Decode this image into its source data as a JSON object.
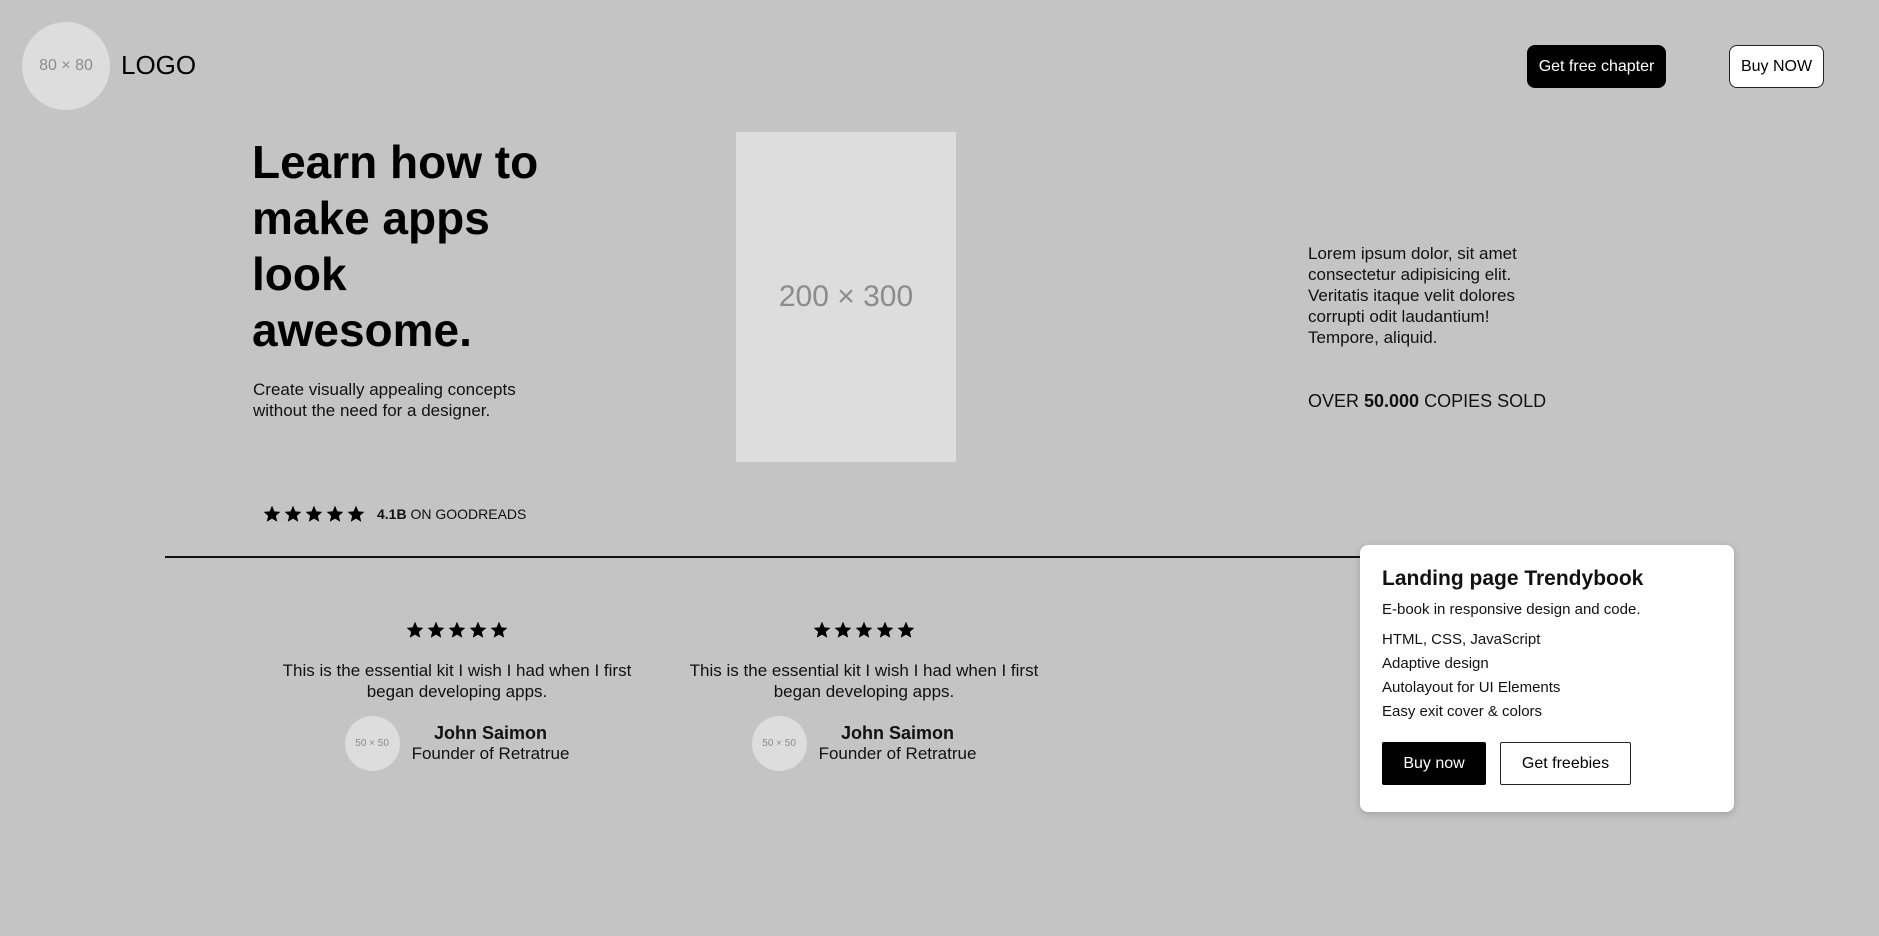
{
  "header": {
    "logo_placeholder": "80 × 80",
    "logo_text": "LOGO",
    "free_chapter_label": "Get free chapter",
    "buy_label": "Buy NOW"
  },
  "hero": {
    "title": "Learn how to make apps look awesome.",
    "subtitle": "Create visually appealing concepts without the need for a designer.",
    "book_placeholder": "200 × 300",
    "description": "Lorem ipsum dolor, sit amet consectetur adipisicing elit. Veritatis itaque velit dolores corrupti odit laudantium! Tempore, aliquid.",
    "copies_prefix": "OVER ",
    "copies_count": "50.000",
    "copies_suffix": " COPIES SOLD"
  },
  "rating": {
    "stars": 5,
    "score": "4.1B",
    "source": "ON GOODREADS"
  },
  "testimonials": [
    {
      "stars": 5,
      "quote": "This is the essential kit I wish I had when I first began developing apps.",
      "avatar_placeholder": "50 × 50",
      "name": "John Saimon",
      "role": "Founder of Retratrue"
    },
    {
      "stars": 5,
      "quote": "This is the essential kit I wish I had when I first began developing apps.",
      "avatar_placeholder": "50 × 50",
      "name": "John Saimon",
      "role": "Founder of Retratrue"
    }
  ],
  "card": {
    "title": "Landing page Trendybook",
    "subtitle": "E-book in responsive design and code.",
    "features": [
      "HTML, CSS, JavaScript",
      "Adaptive design",
      "Autolayout for UI Elements",
      "Easy exit cover & colors"
    ],
    "buy_label": "Buy now",
    "freebies_label": "Get freebies"
  },
  "colors": {
    "background": "#c4c4c4",
    "placeholder": "#dddddd",
    "primary": "#000000",
    "card": "#ffffff"
  }
}
